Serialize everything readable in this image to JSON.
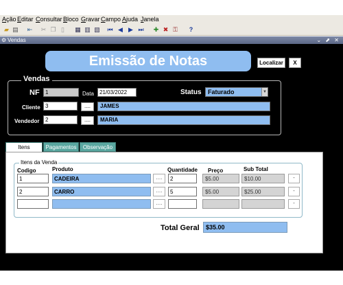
{
  "menu": [
    "Ação",
    "Editar",
    "Consultar",
    "Bloco",
    "Gravar",
    "Campo",
    "Ajuda",
    "Janela"
  ],
  "window": {
    "title": "Vendas",
    "controls": "⌄ ⬈ ✕"
  },
  "banner": "Emissão de Notas",
  "buttons": {
    "localizar": "Localizar",
    "close": "X",
    "dots": "....",
    "row_btn": "-"
  },
  "vendas": {
    "legend": "Vendas",
    "nf_label": "NF",
    "nf_value": "1",
    "data_label": "Data",
    "data_value": "21/03/2022",
    "status_label": "Status",
    "status_value": "Faturado",
    "cliente_label": "Cliente",
    "cliente_code": "3",
    "cliente_name": "JAMES",
    "vendedor_label": "Vendedor",
    "vendedor_code": "2",
    "vendedor_name": "MARIA"
  },
  "tabs": [
    "Itens",
    "Pagamentos",
    "Observação"
  ],
  "items": {
    "legend": "Itens da Venda",
    "headers": {
      "codigo": "Codigo",
      "produto": "Produto",
      "quantidade": "Quantidade",
      "preco": "Preço",
      "subtotal": "Sub Total"
    },
    "rows": [
      {
        "codigo": "1",
        "produto": "CADEIRA",
        "quantidade": "2",
        "preco": "$5.00",
        "subtotal": "$10.00"
      },
      {
        "codigo": "2",
        "produto": "CARRO",
        "quantidade": "5",
        "preco": "$5.00",
        "subtotal": "$25.00"
      },
      {
        "codigo": "",
        "produto": "",
        "quantidade": "",
        "preco": "",
        "subtotal": ""
      }
    ]
  },
  "total": {
    "label": "Total Geral",
    "value": "$35.00"
  }
}
